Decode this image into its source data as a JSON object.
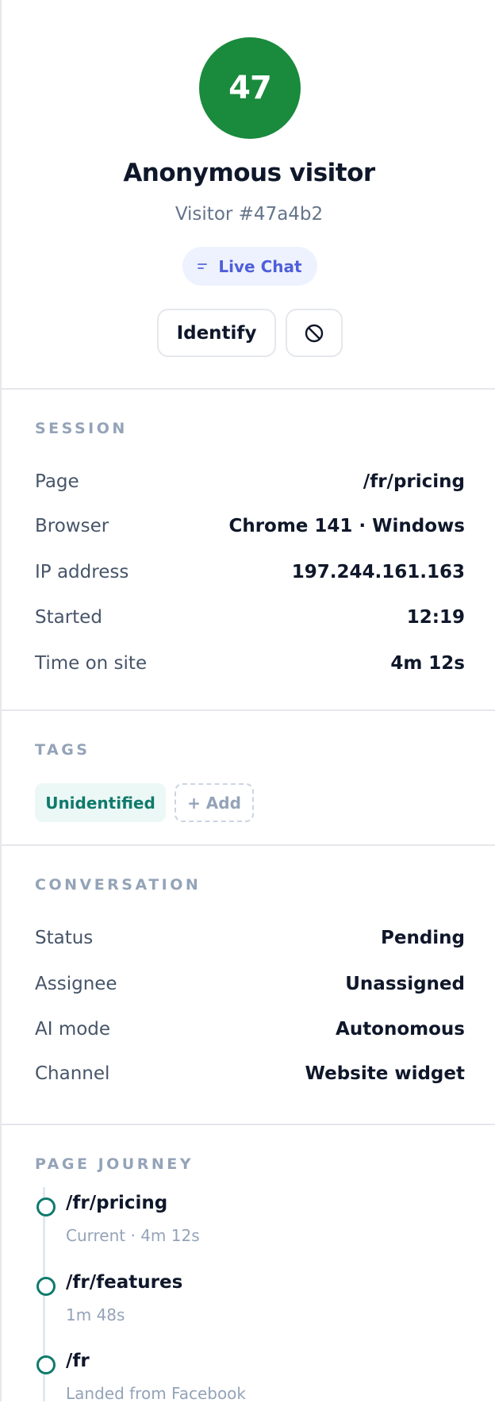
{
  "profile": {
    "avatar_text": "47",
    "name": "Anonymous visitor",
    "visitor_id": "Visitor #47a4b2",
    "channel": "Live Chat",
    "identify_label": "Identify"
  },
  "session": {
    "title": "SESSION",
    "rows": [
      {
        "label": "Page",
        "value": "/fr/pricing"
      },
      {
        "label": "Browser",
        "value": "Chrome 141 · Windows"
      },
      {
        "label": "IP address",
        "value": "197.244.161.163"
      },
      {
        "label": "Started",
        "value": "12:19"
      },
      {
        "label": "Time on site",
        "value": "4m 12s"
      }
    ]
  },
  "tags": {
    "title": "TAGS",
    "items": [
      "Unidentified"
    ],
    "add_label": "+ Add"
  },
  "conversation": {
    "title": "CONVERSATION",
    "rows": [
      {
        "label": "Status",
        "value": "Pending"
      },
      {
        "label": "Assignee",
        "value": "Unassigned"
      },
      {
        "label": "AI mode",
        "value": "Autonomous"
      },
      {
        "label": "Channel",
        "value": "Website widget"
      }
    ]
  },
  "journey": {
    "title": "PAGE JOURNEY",
    "items": [
      {
        "path": "/fr/pricing",
        "meta": "Current · 4m 12s"
      },
      {
        "path": "/fr/features",
        "meta": "1m 48s"
      },
      {
        "path": "/fr",
        "meta": "Landed from Facebook"
      }
    ]
  },
  "colors": {
    "avatar": "#1a8a3d",
    "accent_teal": "#0f7a6c",
    "channel_blue": "#4f5fd9"
  }
}
